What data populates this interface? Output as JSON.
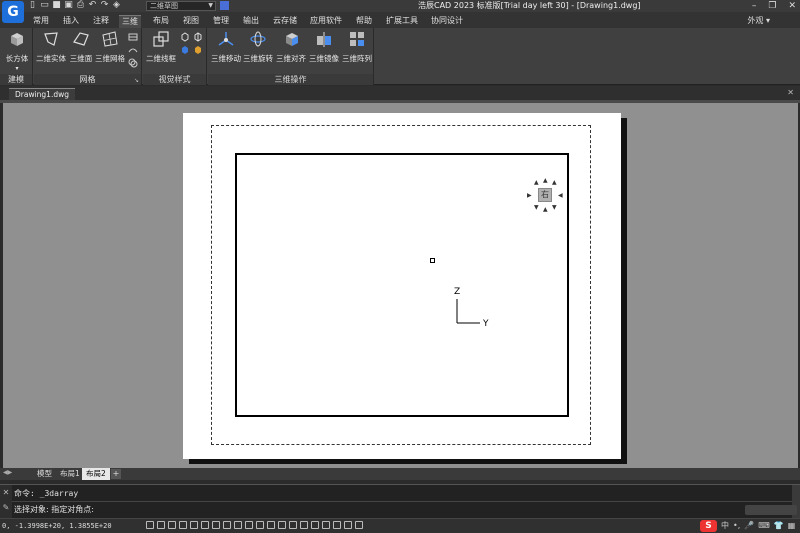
{
  "app": {
    "logo_letter": "G",
    "title": "浩辰CAD 2023 标准版[Trial day left 30] - [Drawing1.dwg]",
    "workspace": "二维草图"
  },
  "quick_access": [
    "new-icon",
    "open-icon",
    "save-icon",
    "save-as-icon",
    "print-icon",
    "undo-icon",
    "redo-icon",
    "layers-icon"
  ],
  "ribbon_tabs": [
    "常用",
    "插入",
    "注释",
    "三维",
    "布局",
    "视图",
    "管理",
    "输出",
    "云存储",
    "应用软件",
    "帮助",
    "扩展工具",
    "协同设计"
  ],
  "active_tab": "三维",
  "view_mode": "外观",
  "ribbon_groups": [
    {
      "label": "建模",
      "buttons": [
        {
          "label": "长方体",
          "icon": "box-icon"
        }
      ]
    },
    {
      "label": "网格",
      "buttons": [
        {
          "label": "二维实体",
          "icon": "solid-2d-icon"
        },
        {
          "label": "三维面",
          "icon": "face-3d-icon"
        },
        {
          "label": "三维网格",
          "icon": "mesh-3d-icon"
        }
      ]
    },
    {
      "label": "视觉样式",
      "buttons": [
        {
          "label": "二维线框",
          "icon": "wireframe-2d-icon"
        }
      ]
    },
    {
      "label": "三维操作",
      "buttons": [
        {
          "label": "三维移动",
          "icon": "move-3d-icon"
        },
        {
          "label": "三维旋转",
          "icon": "rotate-3d-icon"
        },
        {
          "label": "三维对齐",
          "icon": "align-3d-icon"
        },
        {
          "label": "三维镜像",
          "icon": "mirror-3d-icon"
        },
        {
          "label": "三维阵列",
          "icon": "array-3d-icon"
        }
      ]
    }
  ],
  "document": {
    "tab": "Drawing1.dwg"
  },
  "viewcube": {
    "face": "右"
  },
  "ucs": {
    "axis_z": "Z",
    "axis_y": "Y"
  },
  "layout_tabs": {
    "items": [
      "模型",
      "布局1",
      "布局2"
    ],
    "active": "布局2",
    "add": "+"
  },
  "command": {
    "line1": "命令: _3darray",
    "line2": "选择对象: 指定对角点:"
  },
  "status": {
    "coords": "0, -1.3998E+20, 1.3855E+20",
    "ime_logo": "S",
    "ime_lang": "中"
  },
  "colors": {
    "accent": "#1e6fd9",
    "ime": "#e33333"
  }
}
